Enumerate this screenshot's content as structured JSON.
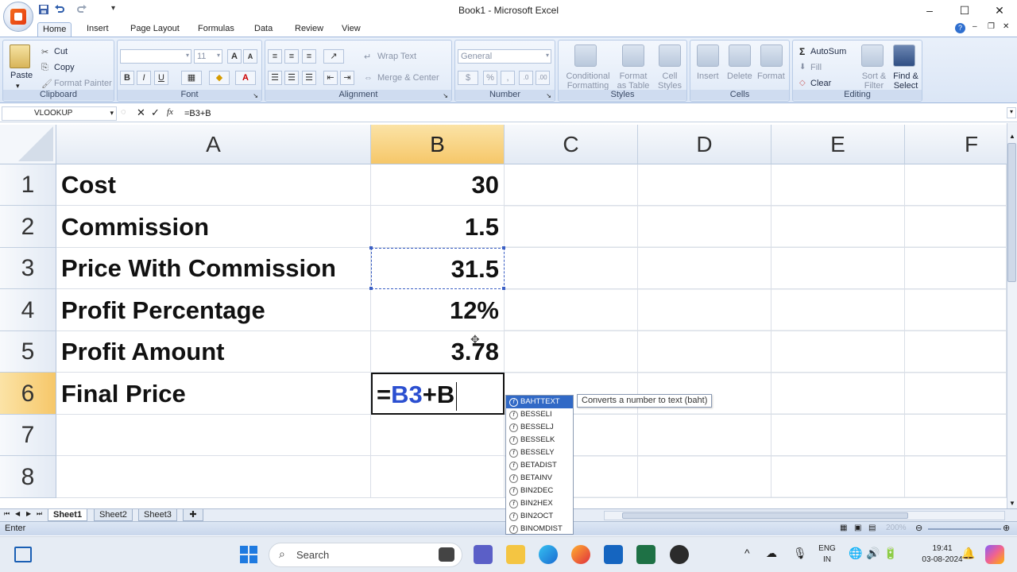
{
  "window": {
    "title": "Book1 - Microsoft Excel",
    "controls": [
      "–",
      "☐",
      "✕"
    ]
  },
  "tabs": [
    "Home",
    "Insert",
    "Page Layout",
    "Formulas",
    "Data",
    "Review",
    "View"
  ],
  "ribbon": {
    "clipboard": {
      "label": "Clipboard",
      "paste": "Paste",
      "cut": "Cut",
      "copy": "Copy",
      "format_painter": "Format Painter"
    },
    "font": {
      "label": "Font",
      "font_size": "11",
      "bold": "B",
      "italic": "I",
      "underline": "U",
      "grow": "A",
      "shrink": "A"
    },
    "alignment": {
      "label": "Alignment",
      "wrap_text": "Wrap Text",
      "merge_center": "Merge & Center"
    },
    "number": {
      "label": "Number",
      "format": "General",
      "percent": "%"
    },
    "styles": {
      "label": "Styles",
      "conditional": "Conditional Formatting",
      "format_table": "Format as Table",
      "cell_styles": "Cell Styles"
    },
    "cells": {
      "label": "Cells",
      "insert": "Insert",
      "delete": "Delete",
      "format": "Format"
    },
    "editing": {
      "label": "Editing",
      "autosum": "AutoSum",
      "fill": "Fill",
      "clear": "Clear",
      "sort_filter": "Sort & Filter",
      "find_select": "Find & Select"
    }
  },
  "formula_bar": {
    "name_box": "VLOOKUP",
    "fx": "fx",
    "formula": "=B3+B"
  },
  "grid": {
    "columns": [
      "A",
      "B",
      "C",
      "D",
      "E",
      "F"
    ],
    "rows": [
      "1",
      "2",
      "3",
      "4",
      "5",
      "6",
      "7",
      "8"
    ],
    "cells": [
      {
        "label": "Cost",
        "value": "30"
      },
      {
        "label": "Commission",
        "value": "1.5"
      },
      {
        "label": "Price With Commission",
        "value": "31.5"
      },
      {
        "label": "Profit Percentage",
        "value": "12%"
      },
      {
        "label": "Profit Amount",
        "value": "3.78"
      },
      {
        "label": "Final Price",
        "value": ""
      }
    ],
    "editing_cell": {
      "eq": "=",
      "ref": "B3",
      "rest": "+B"
    }
  },
  "autocomplete": {
    "items": [
      "BAHTTEXT",
      "BESSELI",
      "BESSELJ",
      "BESSELK",
      "BESSELY",
      "BETADIST",
      "BETAINV",
      "BIN2DEC",
      "BIN2HEX",
      "BIN2OCT",
      "BINOMDIST"
    ],
    "tooltip": "Converts a number to text (baht)"
  },
  "sheets": [
    "Sheet1",
    "Sheet2",
    "Sheet3"
  ],
  "status": {
    "mode": "Enter",
    "zoom": "200%"
  },
  "taskbar": {
    "search": "Search",
    "lang_top": "ENG",
    "lang_bottom": "IN",
    "time": "19:41",
    "date": "03-08-2024"
  }
}
